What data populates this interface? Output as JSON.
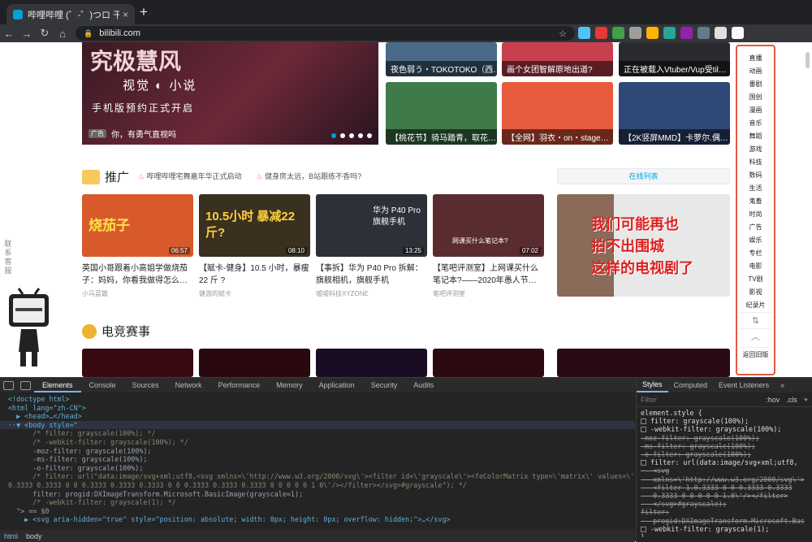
{
  "browser": {
    "tab_title": "哔哩哔哩 (゜-゜)つロ 干杯~-bili",
    "tab_close": "×",
    "new_tab": "+",
    "url": "bilibili.com",
    "nav": {
      "back": "←",
      "forward": "→",
      "reload": "↻",
      "home": "⌂"
    },
    "ext_colors": [
      "#4fc3f7",
      "#e53935",
      "#43a047",
      "#9e9e9e",
      "#ffb300",
      "#26a69a",
      "#8e24aa",
      "#607d8b",
      "#e0e0e0",
      "#fafafa"
    ]
  },
  "banner": {
    "title": "究极慧风",
    "subtitle": "视觉 ◐ 小说",
    "line": "手机版预约正式开启",
    "ad_badge": "广告",
    "caption": "你，有勇气直视吗"
  },
  "top_tiles": [
    {
      "caption": "夜色弱う・TOKOTOKO（西…",
      "color": "#4a6a88"
    },
    {
      "caption": "画个女团智解原地出道?",
      "color": "#c84050"
    },
    {
      "caption": "正在被载入Vtuber/Vup受til…",
      "color": "#2a2a30"
    },
    {
      "caption": "【桃花节】骑马踏青，取花…",
      "color": "#3e7a4a"
    },
    {
      "caption": "【全网】羽衣・on・stage…",
      "color": "#e85a3c"
    },
    {
      "caption": "【2K竖屏MMD】卡萝尔.偶…",
      "color": "#304878"
    }
  ],
  "promo": {
    "title": "推广",
    "news": [
      "哔哩哔哩宅舞嘉年华正式启动",
      "健身房太远，B站跟练不香吗?"
    ],
    "online_list": "在线列表"
  },
  "cards": [
    {
      "title": "英国小哥跟着小高姐学做烧茄子：妈妈，你看我做得怎么…",
      "uploader": "小马蓝散",
      "duration": "06:57",
      "overlay": "烧茄子",
      "color": "#d85a2a"
    },
    {
      "title": "【赋卡-健身】10.5 小时，暴瘦 22 斤 ?",
      "uploader": "健游的赋卡",
      "duration": "08:10",
      "overlay": "10.5小时 暴减22斤?",
      "color": "#3a3020"
    },
    {
      "title": "【事拆】华为 P40 Pro 拆解：旗舰相机，旗舰手机",
      "uploader": "嘘嘘科技XYZONE",
      "duration": "13:25",
      "overlay": "华为 P40 Pro 旗舰手机",
      "color": "#2c3038"
    },
    {
      "title": "【笔吧评测室】上网课买什么笔记本?——2020年愚人节…",
      "uploader": "笔吧评测室",
      "duration": "07:02",
      "overlay": "网课买什么笔记本?",
      "color": "#5a2c30"
    }
  ],
  "big_promo": {
    "text": "我们可能再也拍不出围城这样的电视剧了",
    "lines": [
      "我们可能再也",
      "拍不出围城",
      "这样的电视剧了"
    ]
  },
  "esports": {
    "title": "电竞赛事",
    "tile_colors": [
      "#3a0a12",
      "#2a0810",
      "#1a0c22",
      "#2a0a10",
      "#2a0a12"
    ]
  },
  "sidenav": {
    "items": [
      "直播",
      "动画",
      "番剧",
      "国创",
      "漫画",
      "音乐",
      "舞蹈",
      "游戏",
      "科技",
      "数码",
      "生活",
      "鬼畜",
      "时尚",
      "广告",
      "娱乐",
      "专栏",
      "电影",
      "TV剧",
      "影视",
      "纪录片"
    ],
    "sort_icon": "⇅",
    "up_icon": "︿",
    "back_old": "返回旧版"
  },
  "feedback": "联系客服",
  "devtools": {
    "tabs": [
      "Elements",
      "Console",
      "Sources",
      "Network",
      "Performance",
      "Memory",
      "Application",
      "Security",
      "Audits"
    ],
    "active_tab": "Elements",
    "code_lines": [
      {
        "t": "<!doctype html>"
      },
      {
        "t": "<html lang=\"zh-CN\">"
      },
      {
        "t": "  ▶ <head>…</head>"
      },
      {
        "t": "··▼ <body style=\"",
        "hl": true
      },
      {
        "t": "      /* filter: grayscale(100%); */",
        "c": true
      },
      {
        "t": "      /* -webkit-filter: grayscale(100%); */",
        "c": true
      },
      {
        "t": "      -moz-filter: grayscale(100%);"
      },
      {
        "t": "      -ms-filter: grayscale(100%);"
      },
      {
        "t": "      -o-filter: grayscale(100%);"
      },
      {
        "t": "      /* filter: url(\"data:image/svg+xml;utf8,<svg xmlns=\\'http://www.w3.org/2000/svg\\'><filter id=\\'grayscale\\'><feColorMatrix type=\\'matrix\\' values=\\'0.3333",
        "c": true
      },
      {
        "t": "0.3333 0.3333 0 0 0.3333 0.3333 0.3333 0 0 0.3333 0.3333 0.3333 0 0 0 0 0 1 0\\'/></filter></svg>#grayscale\"); */",
        "c": true
      },
      {
        "t": "      filter: progid:DXImageTransform.Microsoft.BasicImage(grayscale=1);"
      },
      {
        "t": "      /* -webkit-filter: grayscale(1); */",
        "c": true
      },
      {
        "t": "  \"> == $0"
      },
      {
        "t": "    ▶ <svg aria-hidden=\"true\" style=\"position: absolute; width: 0px; height: 0px; overflow: hidden;\">…</svg>"
      }
    ],
    "crumbs": [
      "html",
      "body"
    ],
    "styles_tabs": [
      "Styles",
      "Computed",
      "Event Listeners",
      "»"
    ],
    "filter_placeholder": "Filter",
    "hov": ":hov",
    "cls": ".cls",
    "plus": "+",
    "decls": [
      {
        "t": "element.style {",
        "s": false,
        "cb": false
      },
      {
        "t": "filter: grayscale(100%);",
        "s": false,
        "cb": true
      },
      {
        "t": "-webkit-filter: grayscale(100%);",
        "s": false,
        "cb": true
      },
      {
        "t": "-moz-filter: grayscale(100%);",
        "s": true,
        "cb": false
      },
      {
        "t": "-ms-filter: grayscale(100%);",
        "s": true,
        "cb": false
      },
      {
        "t": "-o-filter: grayscale(100%);",
        "s": true,
        "cb": false
      },
      {
        "t": "filter: url(data:image/svg+xml;utf8,",
        "s": false,
        "cb": true
      },
      {
        "t": "   <svg",
        "s": true,
        "cb": false
      },
      {
        "t": "   xmlns=\\'http://www.w3.org/2000/svg\\'>",
        "s": true,
        "cb": false
      },
      {
        "t": "   <filter 1.0.3333 0 0 0.3333 0.3333",
        "s": true,
        "cb": false
      },
      {
        "t": "   0.3333 0 0 0 0 0 1.0\\'/></filter>",
        "s": true,
        "cb": false
      },
      {
        "t": "   </svg>#grayscale);",
        "s": true,
        "cb": false
      },
      {
        "t": "filter:",
        "s": true,
        "cb": false
      },
      {
        "t": "   progid:DXImageTransform.Microsoft.Bas",
        "s": true,
        "cb": false
      },
      {
        "t": "-webkit-filter: grayscale(1);",
        "s": false,
        "cb": true
      },
      {
        "t": "}",
        "s": false,
        "cb": false
      }
    ]
  }
}
